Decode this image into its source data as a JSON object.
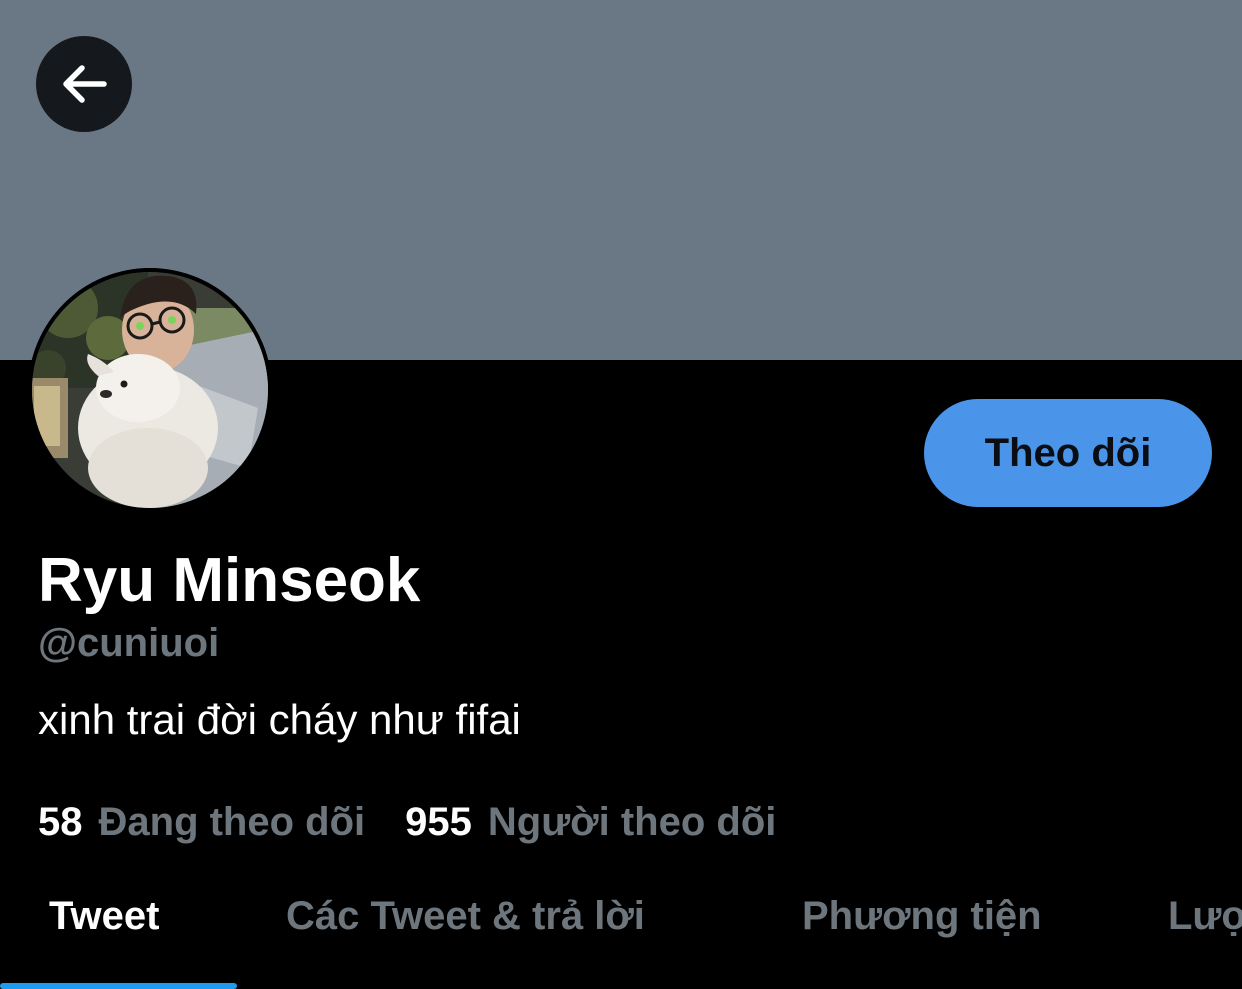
{
  "header": {
    "banner_color": "#6a7785",
    "back_icon": "arrow-left-icon"
  },
  "profile": {
    "display_name": "Ryu Minseok",
    "handle": "@cuniuoi",
    "bio": "xinh trai đời cháy như fifai",
    "follow_button_label": "Theo dõi",
    "accent_color": "#4a95ea"
  },
  "stats": {
    "following_count": "58",
    "following_label": "Đang theo dõi",
    "followers_count": "955",
    "followers_label": "Người theo dõi"
  },
  "tabs": [
    {
      "label": "Tweet",
      "active": true
    },
    {
      "label": "Các Tweet & trả lời",
      "active": false
    },
    {
      "label": "Phương tiện",
      "active": false
    },
    {
      "label": "Lượt thích",
      "active": false
    }
  ]
}
